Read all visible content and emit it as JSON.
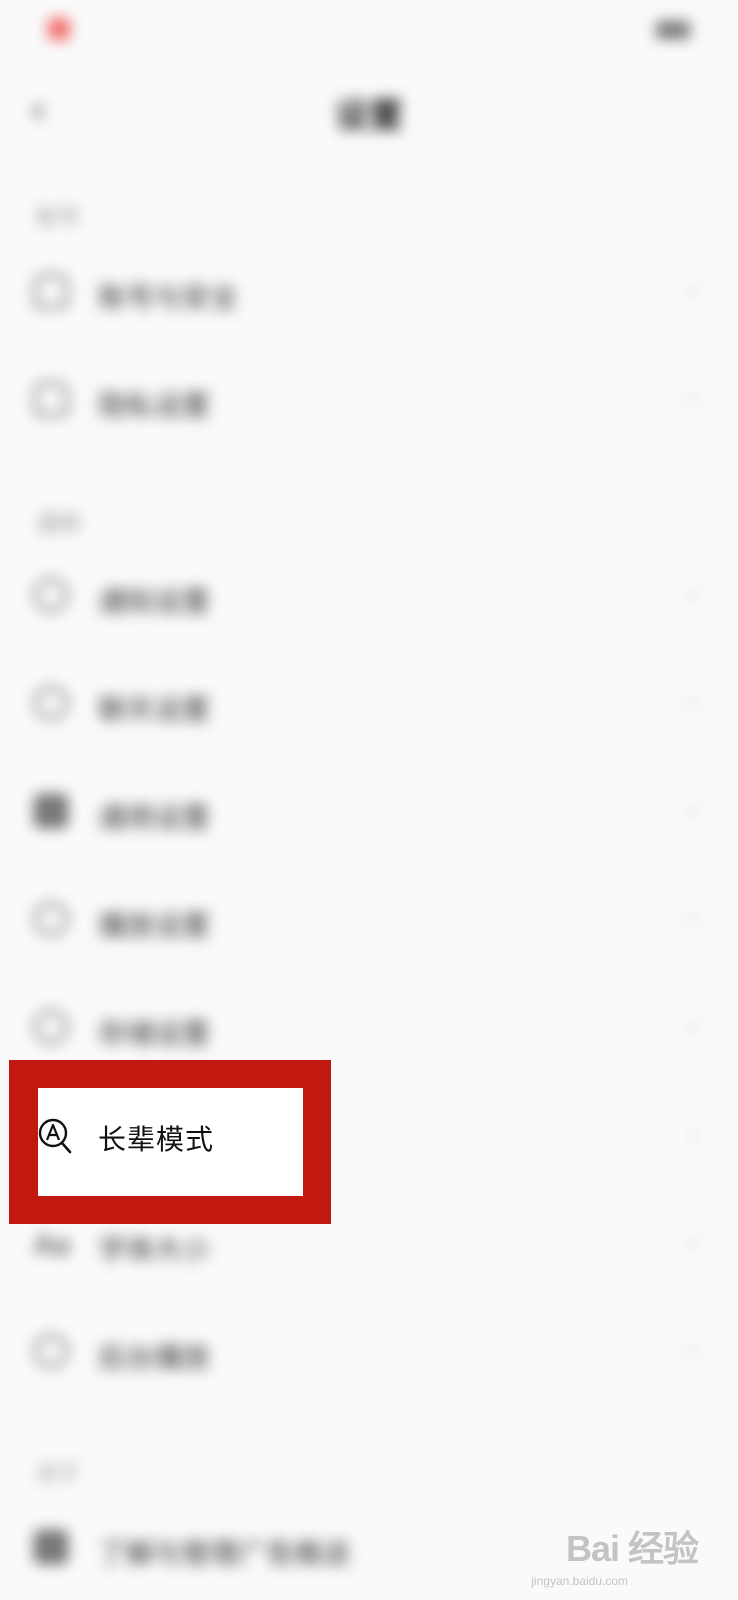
{
  "status_bar": {
    "time": "",
    "battery": ""
  },
  "nav": {
    "title": "设置"
  },
  "sections": [
    {
      "header": "账号"
    },
    {
      "header": "通用"
    },
    {
      "header": "关于"
    }
  ],
  "menu": {
    "account_security": "账号与安全",
    "privacy": "隐私设置",
    "notification": "通知设置",
    "chat": "聊天设置",
    "general": "通用设置",
    "playback": "播放设置",
    "storage": "存储设置",
    "elder_mode": "长辈模式",
    "font_size": "字体大小",
    "background": "后台播放",
    "about_ads": "了解与管理广告推送"
  },
  "icons": {
    "elder_mode_icon": "magnifier-a-icon"
  },
  "colors": {
    "highlight": "#c1180f"
  },
  "watermark": {
    "logo": "Bai 经验",
    "sub": "jingyan.baidu.com"
  }
}
